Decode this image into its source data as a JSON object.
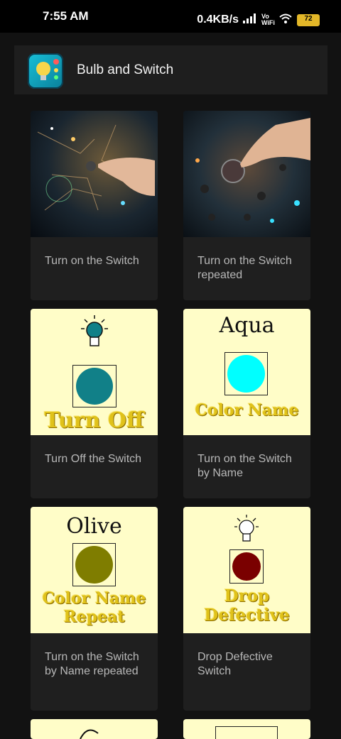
{
  "status": {
    "time": "7:55 AM",
    "speed": "0.4KB/s",
    "network": "Vo WiFi",
    "battery": "72"
  },
  "app": {
    "title": "Bulb and Switch"
  },
  "cards": [
    {
      "label": "Turn on the Switch"
    },
    {
      "label": "Turn on the Switch repeated"
    },
    {
      "label": "Turn Off the Switch",
      "image_text": "Turn Off",
      "circle_color": "#118088"
    },
    {
      "label": "Turn on the Switch by Name",
      "image_top": "Aqua",
      "image_bottom": "Color Name",
      "circle_color": "#00ffff"
    },
    {
      "label": "Turn on the Switch by Name repeated",
      "image_top": "Olive",
      "image_bottom_1": "Color Name",
      "image_bottom_2": "Repeat",
      "circle_color": "#7f7d00"
    },
    {
      "label": "Drop Defective Switch",
      "image_bottom_1": "Drop",
      "image_bottom_2": "Defective",
      "circle_color": "#7a0000"
    }
  ],
  "colors": {
    "background": "#121212",
    "card": "#1f1f1f",
    "cream": "#fffdc8",
    "gold": "#e0c21a"
  }
}
